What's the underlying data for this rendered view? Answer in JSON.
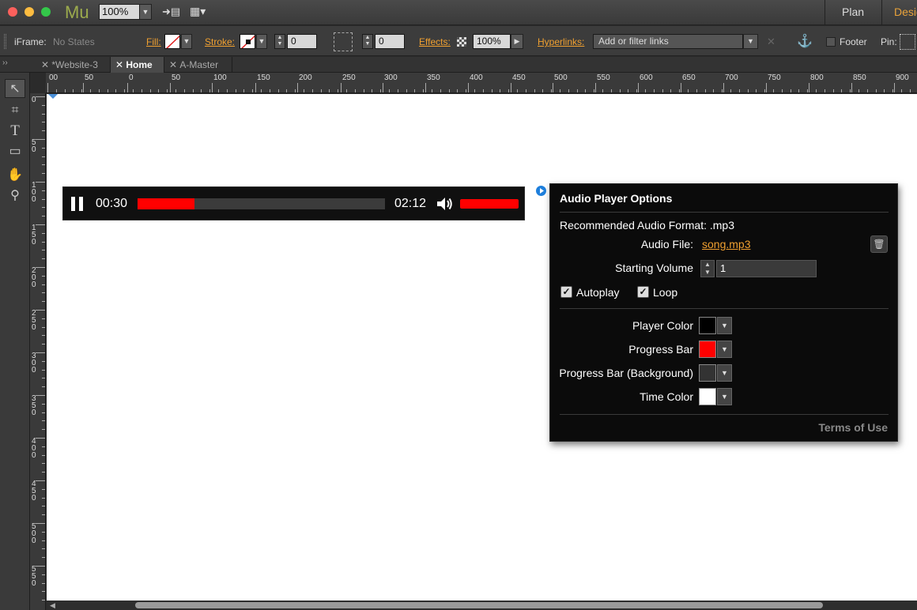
{
  "titlebar": {
    "logo": "Mu",
    "zoom": "100%",
    "plan": "Plan",
    "design": "Design"
  },
  "controlbar": {
    "iframe_label": "iFrame:",
    "iframe_value": "No States",
    "fill_label": "Fill:",
    "stroke_label": "Stroke:",
    "stroke_value": "0",
    "corner_value": "0",
    "effects_label": "Effects:",
    "effects_value": "100%",
    "hyperlinks_label": "Hyperlinks:",
    "hyperlinks_placeholder": "Add or filter links",
    "footer_label": "Footer",
    "pin_label": "Pin:"
  },
  "tabs": [
    {
      "label": "*Website-3"
    },
    {
      "label": "Home"
    },
    {
      "label": "A-Master"
    }
  ],
  "rulers": {
    "h": [
      "00",
      "50",
      "0",
      "50",
      "100",
      "150",
      "200",
      "250",
      "300",
      "350",
      "400",
      "450",
      "500",
      "550",
      "600",
      "650",
      "700",
      "750",
      "800",
      "850",
      "900"
    ],
    "v": [
      "0",
      "50",
      "100",
      "150",
      "200",
      "250",
      "300",
      "350",
      "400",
      "450",
      "500",
      "550"
    ]
  },
  "player": {
    "elapsed": "00:30",
    "duration": "02:12",
    "progress_fraction": 0.23,
    "volume_fraction": 1.0,
    "player_color": "#000000",
    "progress_color": "#ff0000"
  },
  "panel": {
    "title": "Audio Player Options",
    "recommended": "Recommended Audio Format: .mp3",
    "audio_file_label": "Audio File:",
    "audio_file_value": "song.mp3",
    "starting_volume_label": "Starting Volume",
    "starting_volume_value": "1",
    "autoplay_label": "Autoplay",
    "loop_label": "Loop",
    "player_color_label": "Player Color",
    "progress_bar_label": "Progress Bar",
    "progress_bg_label": "Progress Bar (Background)",
    "time_color_label": "Time Color",
    "terms": "Terms of Use",
    "colors": {
      "player": "#000000",
      "progress": "#ff0000",
      "progress_bg": "#333333",
      "time": "#ffffff"
    }
  }
}
